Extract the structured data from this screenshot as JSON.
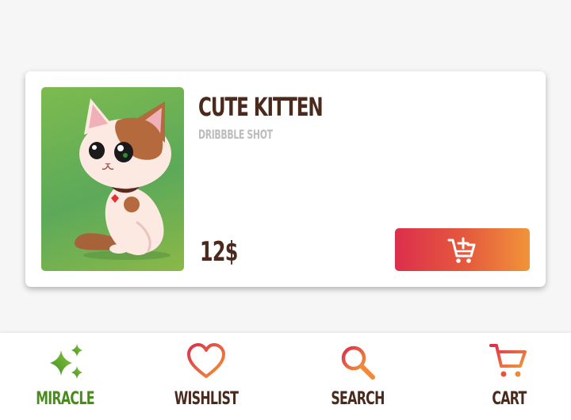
{
  "product": {
    "title": "CUTE KITTEN",
    "subtitle": "DRIBBBLE SHOT",
    "price": "12$",
    "image": "kitten-illustration",
    "add_to_cart_icon": "cart-plus-icon"
  },
  "nav": {
    "items": [
      {
        "label": "MIRACLE",
        "icon": "sparkles-icon",
        "color": "#4a8b1e",
        "active": true
      },
      {
        "label": "WISHLIST",
        "icon": "heart-icon",
        "color": "#4b2a1e",
        "active": false
      },
      {
        "label": "SEARCH",
        "icon": "search-icon",
        "color": "#4b2a1e",
        "active": false
      },
      {
        "label": "CART",
        "icon": "cart-icon",
        "color": "#4b2a1e",
        "active": false
      }
    ]
  },
  "colors": {
    "title": "#4b2a1e",
    "subtitle": "#bdbdbd",
    "gradient_start": "#dc2f4c",
    "gradient_end": "#f0943a",
    "active_green": "#4a8b1e"
  }
}
